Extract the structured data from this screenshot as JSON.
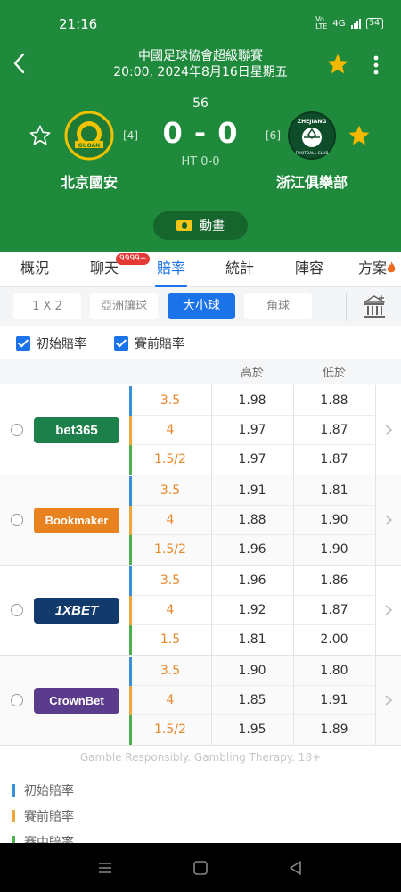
{
  "status": {
    "time": "21:16",
    "net": "4G",
    "battery": "54"
  },
  "header": {
    "league": "中國足球協會超級聯賽",
    "date": "20:00, 2024年8月16日星期五",
    "minute": "56",
    "score": "0 - 0",
    "ht": "HT 0-0",
    "home": {
      "name": "北京國安",
      "rank": "[4]"
    },
    "away": {
      "name": "浙江俱樂部",
      "rank": "[6]"
    },
    "animation_label": "動畫"
  },
  "tabs": [
    {
      "label": "概況"
    },
    {
      "label": "聊天"
    },
    {
      "label": "賠率"
    },
    {
      "label": "統計"
    },
    {
      "label": "陣容"
    },
    {
      "label": "方案"
    }
  ],
  "chat_badge": "9999+",
  "subtabs": [
    "1 X 2",
    "亞洲讓球",
    "大小球",
    "角球"
  ],
  "checks": [
    "初始賠率",
    "賽前賠率"
  ],
  "table": {
    "headers": {
      "over": "高於",
      "under": "低於"
    },
    "books": [
      {
        "name": "bet365",
        "color": "#1d7f4a",
        "rows": [
          {
            "line": "3.5",
            "over": "1.98",
            "under": "1.88"
          },
          {
            "line": "4",
            "over": "1.97",
            "under": "1.87"
          },
          {
            "line": "1.5/2",
            "over": "1.97",
            "under": "1.87"
          }
        ]
      },
      {
        "name": "Bookmaker",
        "color": "#e8821e",
        "rows": [
          {
            "line": "3.5",
            "over": "1.91",
            "under": "1.81"
          },
          {
            "line": "4",
            "over": "1.88",
            "under": "1.90"
          },
          {
            "line": "1.5/2",
            "over": "1.96",
            "under": "1.90"
          }
        ]
      },
      {
        "name": "1XBET",
        "color": "#123a6b",
        "rows": [
          {
            "line": "3.5",
            "over": "1.96",
            "under": "1.86"
          },
          {
            "line": "4",
            "over": "1.92",
            "under": "1.87"
          },
          {
            "line": "1.5",
            "over": "1.81",
            "under": "2.00"
          }
        ]
      },
      {
        "name": "CrownBet",
        "color": "#5a3b8c",
        "rows": [
          {
            "line": "3.5",
            "over": "1.90",
            "under": "1.80"
          },
          {
            "line": "4",
            "over": "1.85",
            "under": "1.91"
          },
          {
            "line": "1.5/2",
            "over": "1.95",
            "under": "1.89"
          }
        ]
      }
    ]
  },
  "responsible": "Gamble Responsibly. Gambling Therapy. 18+",
  "legend": [
    {
      "label": "初始賠率",
      "color": "#3d8fd8"
    },
    {
      "label": "賽前賠率",
      "color": "#f0a640"
    },
    {
      "label": "賽中賠率",
      "color": "#4caf50"
    }
  ],
  "colors": {
    "header_green": "#1f8a3c",
    "accent_blue": "#1a73e8",
    "star_yellow": "#f5b800",
    "line_orange": "#e8872a"
  }
}
